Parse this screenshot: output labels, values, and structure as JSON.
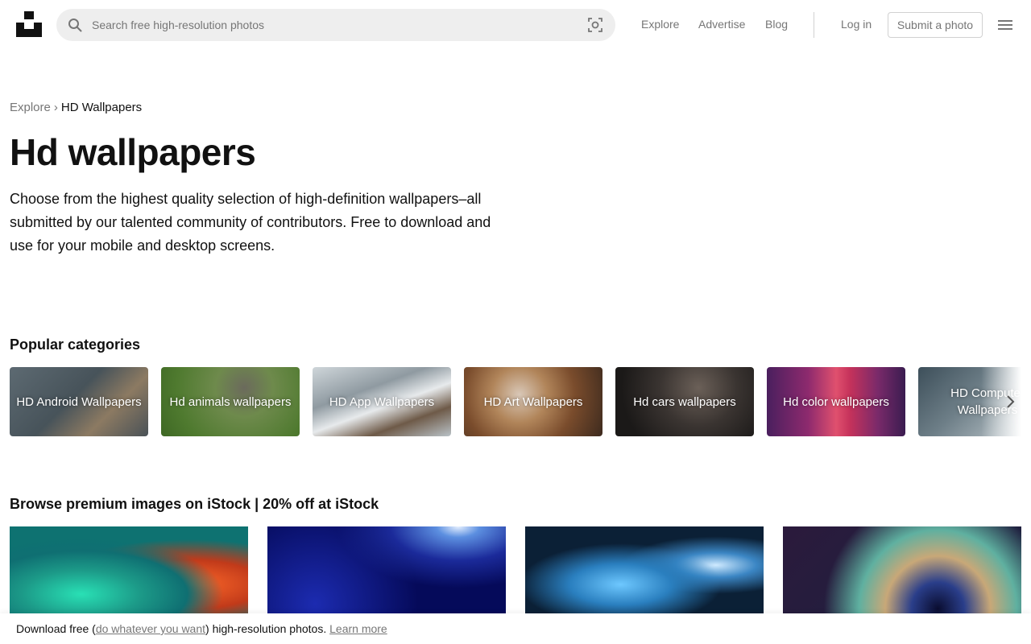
{
  "header": {
    "search_placeholder": "Search free high-resolution photos",
    "nav": [
      "Explore",
      "Advertise",
      "Blog"
    ],
    "login": "Log in",
    "submit": "Submit a photo"
  },
  "breadcrumb": {
    "root": "Explore",
    "separator": "›",
    "current": "HD Wallpapers"
  },
  "page": {
    "title": "Hd wallpapers",
    "description": "Choose from the highest quality selection of high-definition wallpapers–all submitted by our talented community of contributors. Free to download and use for your mobile and desktop screens."
  },
  "categories": {
    "title": "Popular categories",
    "items": [
      "HD Android Wallpapers",
      "Hd animals wallpapers",
      "HD App Wallpapers",
      "HD Art Wallpapers",
      "Hd cars wallpapers",
      "Hd color wallpapers",
      "HD Computer Wallpapers"
    ]
  },
  "istock": {
    "title_bold": "Browse premium images on iStock",
    "title_rest": " | 20% off at iStock"
  },
  "banner": {
    "prefix": "Download free (",
    "link": "do whatever you want",
    "suffix": ") high-resolution photos.",
    "learn": "Learn more"
  },
  "colors": {
    "text": "#111111",
    "muted": "#767676",
    "search_bg": "#eeeeee",
    "border": "#d1d1d1"
  },
  "icons": [
    "unsplash-logo-icon",
    "search-icon",
    "visual-search-icon",
    "hamburger-menu-icon",
    "chevron-right-icon"
  ]
}
